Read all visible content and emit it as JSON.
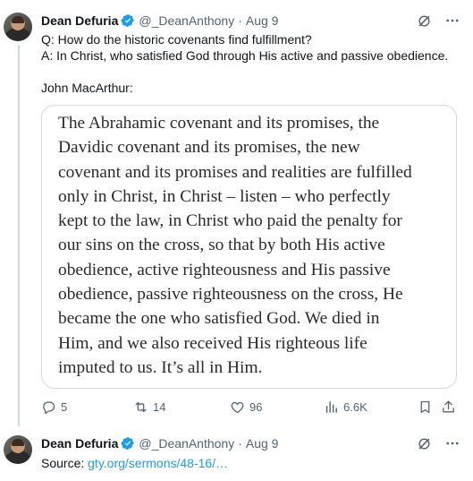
{
  "tweet1": {
    "name": "Dean Defuria",
    "handle": "@_DeanAnthony",
    "separator": "·",
    "date": "Aug 9",
    "lines": [
      "Q: How do the historic covenants find fulfillment?",
      "A: In Christ, who satisfied God through His active and passive obedience."
    ],
    "attribution": "John MacArthur:",
    "quote_lines": [
      "The Abrahamic covenant and its promises, the",
      "Davidic covenant and its promises, the new",
      "covenant and its promises and realities are fulfilled",
      "only in Christ, in Christ – listen – who perfectly",
      "kept to the law, in Christ who paid the penalty for",
      "our sins on the cross, so that by both His active",
      "obedience, active righteousness and His passive",
      "obedience, passive righteousness on the cross, He",
      "became the one who satisfied God. We died in",
      "Him, and we also received His righteous life",
      "imputed to us. It’s all in Him."
    ],
    "actions": {
      "replies": "5",
      "reposts": "14",
      "likes": "96",
      "views": "6.6K"
    }
  },
  "tweet2": {
    "name": "Dean Defuria",
    "handle": "@_DeanAnthony",
    "separator": "·",
    "date": "Aug 9",
    "source_label": "Source:",
    "source_link": "gty.org/sermons/48-16/…"
  },
  "colors": {
    "verified": "#1d9bf0",
    "link": "#1d9bf0",
    "muted": "#536471",
    "border": "#cfd9de"
  },
  "icons": [
    "verified-badge-icon",
    "grok-icon",
    "more-icon",
    "reply-icon",
    "repost-icon",
    "like-icon",
    "views-icon",
    "bookmark-icon",
    "share-icon"
  ]
}
